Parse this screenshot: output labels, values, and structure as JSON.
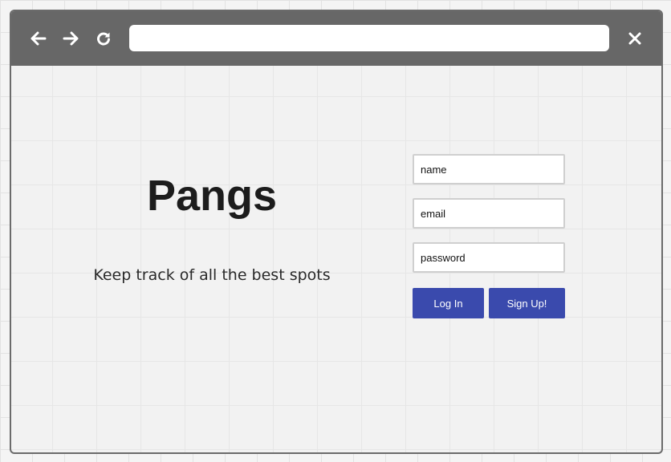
{
  "toolbar": {
    "back_icon": "arrow-left-icon",
    "forward_icon": "arrow-right-icon",
    "reload_icon": "reload-icon",
    "close_icon": "close-icon",
    "address_value": ""
  },
  "main": {
    "title": "Pangs",
    "tagline": "Keep track of all the best spots"
  },
  "form": {
    "name_placeholder": "name",
    "email_placeholder": "email",
    "password_placeholder": "password",
    "login_label": "Log In",
    "signup_label": "Sign Up!"
  },
  "colors": {
    "toolbar": "#676767",
    "button": "#3a4aad",
    "title": "#1c1c1c"
  }
}
